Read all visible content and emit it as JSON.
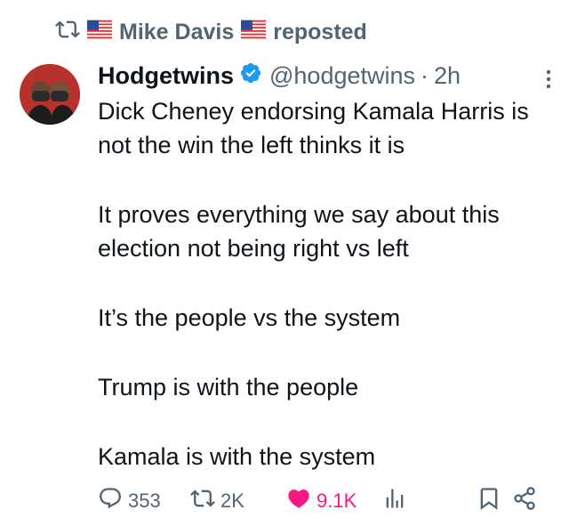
{
  "repost": {
    "user": "Mike Davis",
    "label": "reposted",
    "icon": "retweet-icon"
  },
  "author": {
    "name": "Hodgetwins",
    "handle": "@hodgetwins",
    "separator": "·",
    "time": "2h"
  },
  "tweet": {
    "paragraphs": [
      "Dick Cheney endorsing Kamala Harris is not the win the left thinks it is",
      "It proves everything we say about this election not being right vs left",
      "It’s the people vs the system",
      "Trump is with the people",
      "Kamala is with the system"
    ]
  },
  "actions": {
    "replies": "353",
    "reposts": "2K",
    "likes": "9.1K"
  },
  "colors": {
    "secondary_text": "#536471",
    "like": "#f91880",
    "verified": "#1d9bf0"
  }
}
